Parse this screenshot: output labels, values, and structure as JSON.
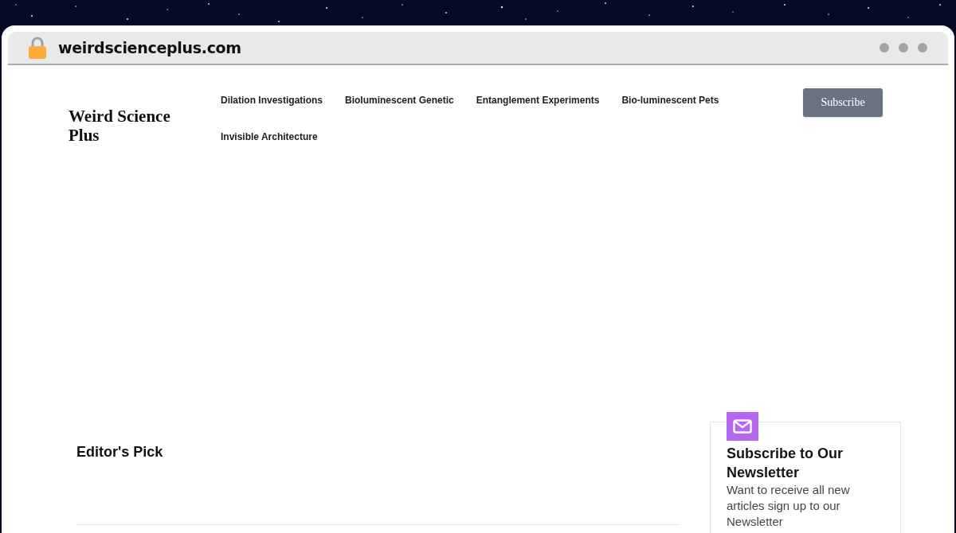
{
  "browser": {
    "url": "weirdscienceplus.com"
  },
  "header": {
    "logo": "Weird Science Plus",
    "nav": [
      {
        "label": "Dilation Investigations"
      },
      {
        "label": "Bioluminescent Genetic"
      },
      {
        "label": "Entanglement Experiments"
      },
      {
        "label": "Bio-luminescent Pets"
      },
      {
        "label": "Invisible Architecture"
      }
    ],
    "subscribe_button": "Subscribe"
  },
  "editors_pick": {
    "title": "Editor's Pick"
  },
  "newsletter": {
    "title": "Subscribe to Our Newsletter",
    "text": "Want to receive all new articles sign up to our Newsletter"
  }
}
